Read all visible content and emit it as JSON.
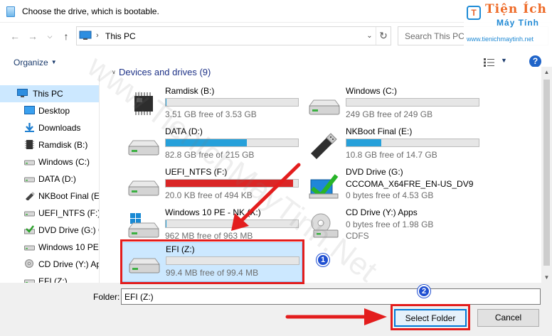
{
  "window": {
    "title": "Choose the drive, which is bootable."
  },
  "nav": {
    "breadcrumb_sep": "›",
    "path": "This PC",
    "search_placeholder": "Search This PC"
  },
  "watermark": {
    "logo_line1": "Tiện Ích",
    "logo_line2": "Máy Tính",
    "logo_url": "www.tienichmaytinh.net",
    "diagonal_text": "www.TienIchMayTinh.Net"
  },
  "toolbar": {
    "organize_label": "Organize"
  },
  "sidebar": {
    "items": [
      {
        "label": "This PC",
        "icon": "pc-icon"
      },
      {
        "label": "Desktop",
        "icon": "desktop-icon"
      },
      {
        "label": "Downloads",
        "icon": "downloads-icon"
      },
      {
        "label": "Ramdisk (B:)",
        "icon": "ramdisk-icon"
      },
      {
        "label": "Windows (C:)",
        "icon": "drive-icon"
      },
      {
        "label": "DATA (D:)",
        "icon": "drive-icon"
      },
      {
        "label": "NKBoot Final (E:",
        "icon": "usb-icon"
      },
      {
        "label": "UEFI_NTFS (F:)",
        "icon": "drive-icon"
      },
      {
        "label": "DVD Drive (G:) C",
        "icon": "dvd-icon"
      },
      {
        "label": "Windows 10 PE -",
        "icon": "drive-icon"
      },
      {
        "label": "CD Drive (Y:) Ap",
        "icon": "cd-icon"
      },
      {
        "label": "EFI (Z:)",
        "icon": "drive-icon"
      }
    ]
  },
  "main": {
    "group_header": "Devices and drives (9)",
    "drives": [
      {
        "name": "Ramdisk (B:)",
        "free": "3.51 GB free of 3.53 GB",
        "used_fraction": 0.006,
        "bar": "blue",
        "icon": "ramdisk-icon"
      },
      {
        "name": "Windows (C:)",
        "free": "249 GB free of 249 GB",
        "used_fraction": 0.0,
        "bar": "blue",
        "icon": "drive-icon"
      },
      {
        "name": "DATA (D:)",
        "free": "82.8 GB free of 215 GB",
        "used_fraction": 0.615,
        "bar": "blue",
        "icon": "drive-icon"
      },
      {
        "name": "NKBoot Final (E:)",
        "free": "10.8 GB free of 14.7 GB",
        "used_fraction": 0.265,
        "bar": "blue",
        "icon": "usb-icon"
      },
      {
        "name": "UEFI_NTFS (F:)",
        "free": "20.0 KB free of 494 KB",
        "used_fraction": 0.96,
        "bar": "red",
        "icon": "drive-icon"
      },
      {
        "name": "DVD Drive (G:)",
        "subtitle": "CCCOMA_X64FRE_EN-US_DV9",
        "free": "0 bytes free of 4.53 GB",
        "icon": "dvd-icon"
      },
      {
        "name": "Windows 10 PE - NK (X:)",
        "free": "962 MB free of 963 MB",
        "used_fraction": 0.001,
        "bar": "blue",
        "icon": "windows-drive-icon"
      },
      {
        "name": "CD Drive (Y:) Apps",
        "free": "0 bytes free of 1.98 GB",
        "fs": "CDFS",
        "icon": "cd-icon"
      },
      {
        "name": "EFI (Z:)",
        "free": "99.4 MB free of 99.4 MB",
        "used_fraction": 0.0,
        "bar": "blue",
        "icon": "drive-icon"
      }
    ]
  },
  "bottom": {
    "folder_label": "Folder:",
    "folder_value": "EFI (Z:)",
    "select_button": "Select Folder",
    "cancel_button": "Cancel"
  },
  "annotations": {
    "badge1": "1",
    "badge2": "2",
    "color": "#e31d1d",
    "badge_color": "#1f4fd1"
  },
  "colors": {
    "accent": "#0078d7",
    "bar_fill": "#26a0da",
    "bar_full": "#da2626",
    "selection": "#cce8ff"
  }
}
